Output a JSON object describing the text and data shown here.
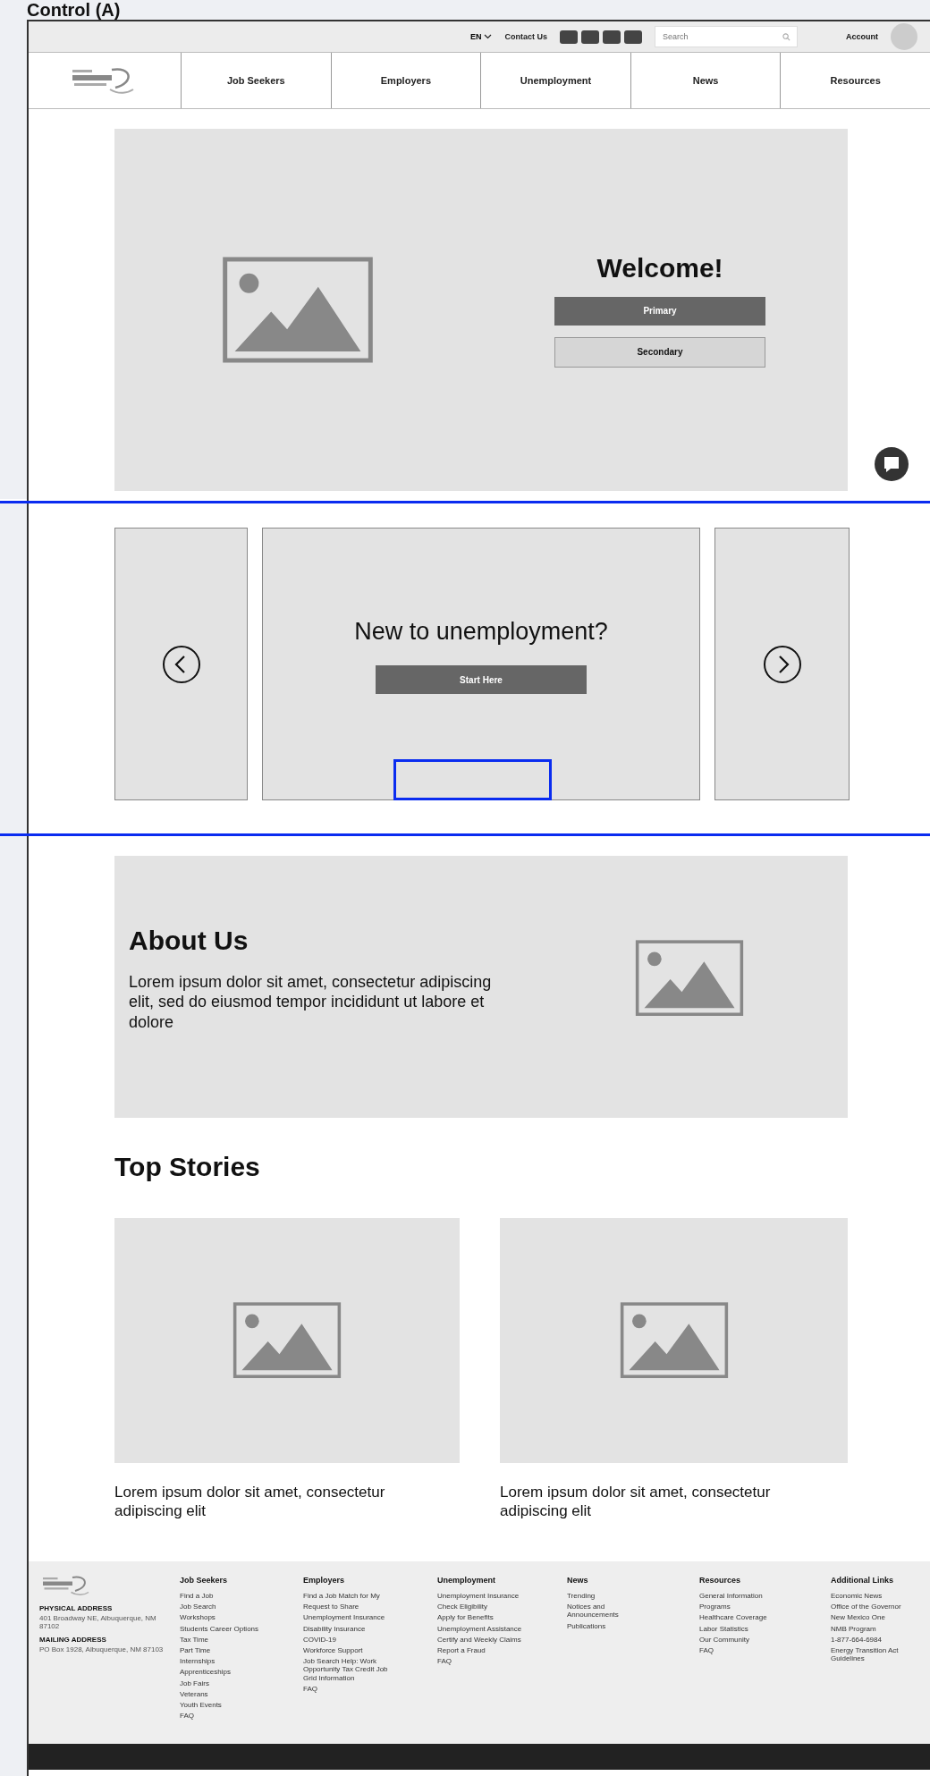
{
  "heading": "Control (A)",
  "top_bar": {
    "language": "EN",
    "contact": "Contact Us",
    "search": {
      "placeholder": "Search"
    },
    "account": "Account"
  },
  "nav": {
    "tabs": [
      {
        "label": "Job Seekers",
        "selected": false
      },
      {
        "label": "Employers",
        "selected": false
      },
      {
        "label": "Unemployment",
        "selected": false
      },
      {
        "label": "News",
        "selected": false
      },
      {
        "label": "Resources",
        "selected": false
      }
    ]
  },
  "hero": {
    "title": "Welcome!",
    "buttons": [
      {
        "label": "Primary",
        "kind": "primary"
      },
      {
        "label": "Secondary",
        "kind": "secondary"
      }
    ]
  },
  "carousel": {
    "title": "New to unemployment?",
    "button": "Start Here"
  },
  "about": {
    "title": "About Us",
    "text": "Lorem ipsum dolor sit amet, consectetur adipiscing elit, sed do eiusmod tempor incididunt ut labore et dolore"
  },
  "stories": {
    "title": "Top Stories",
    "items": [
      {
        "caption": "Lorem ipsum dolor sit amet, consectetur adipiscing elit"
      },
      {
        "caption": "Lorem ipsum dolor sit amet, consectetur adipiscing elit"
      }
    ]
  },
  "footer": {
    "addresses": [
      {
        "title": "PHYSICAL ADDRESS",
        "text": "401 Broadway NE, Albuquerque, NM 87102"
      },
      {
        "title": "MAILING ADDRESS",
        "text": "PO Box 1928, Albuquerque, NM 87103"
      }
    ],
    "columns": [
      {
        "title": "Job Seekers",
        "links": [
          "Find a Job",
          "Job Search",
          "Workshops",
          "Students Career Options",
          "Tax Time",
          "Part Time",
          "Internships",
          "Apprenticeships",
          "Job Fairs",
          "Veterans",
          "Youth Events",
          "FAQ"
        ]
      },
      {
        "title": "Employers",
        "links": [
          "Find a Job Match for My",
          "Request to Share",
          "Unemployment Insurance",
          "Disability Insurance",
          "COVID-19",
          "Workforce Support",
          "Job Search Help: Work Opportunity Tax Credit Job Grid Information",
          "FAQ"
        ]
      },
      {
        "title": "Unemployment",
        "links": [
          "Unemployment Insurance",
          "Check Eligibility",
          "Apply for Benefits",
          "Unemployment Assistance",
          "Certify and Weekly Claims",
          "Report a Fraud",
          "FAQ"
        ]
      },
      {
        "title": "News",
        "links": [
          "Trending",
          "Notices and Announcements",
          "Publications"
        ]
      },
      {
        "title": "Resources",
        "links": [
          "General Information",
          "Programs",
          "Healthcare Coverage",
          "Labor Statistics",
          "Our Community",
          "FAQ"
        ]
      },
      {
        "title": "Additional Links",
        "links": [
          "Economic News",
          "Office of the Governor",
          "New Mexico One",
          "NMB Program",
          "1-877-664-6984",
          "Energy Transition Act Guidelines"
        ]
      }
    ]
  }
}
